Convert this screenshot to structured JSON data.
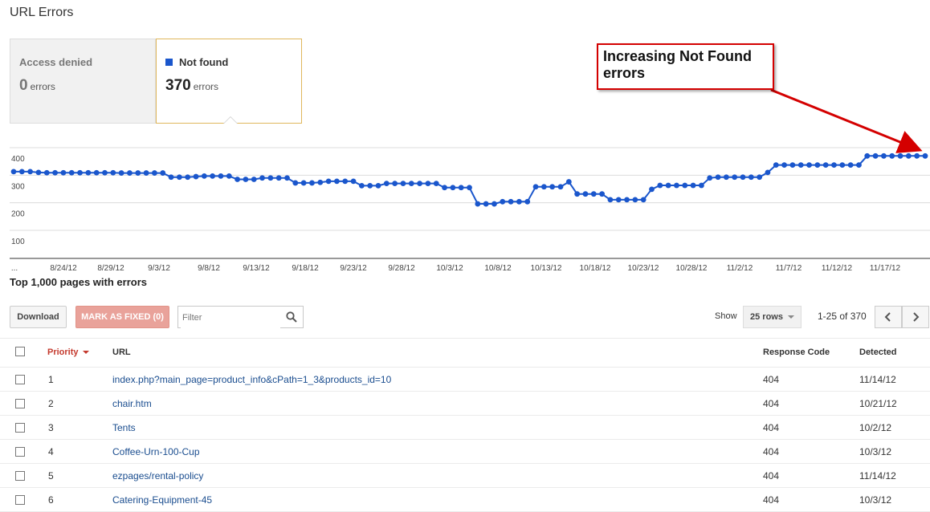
{
  "page": {
    "title": "URL Errors"
  },
  "tiles": [
    {
      "label": "Access denied",
      "count": "0",
      "unit": "errors",
      "selected": false
    },
    {
      "label": "Not found",
      "count": "370",
      "unit": "errors",
      "selected": true,
      "color": "#1a56cc"
    }
  ],
  "annotation": {
    "line1": "Increasing Not Found",
    "line2": "errors",
    "color": "#d40000"
  },
  "chart_data": {
    "type": "line",
    "series": [
      {
        "name": "Not found",
        "color": "#1a56cc",
        "values": [
          313,
          313,
          313,
          310,
          309,
          309,
          309,
          309,
          309,
          309,
          309,
          309,
          309,
          308,
          308,
          308,
          308,
          308,
          308,
          293,
          293,
          293,
          295,
          297,
          297,
          297,
          297,
          285,
          285,
          285,
          290,
          290,
          290,
          290,
          272,
          272,
          272,
          274,
          278,
          278,
          278,
          278,
          262,
          262,
          262,
          270,
          270,
          270,
          270,
          270,
          270,
          270,
          255,
          255,
          255,
          255,
          196,
          196,
          196,
          204,
          204,
          204,
          204,
          258,
          258,
          258,
          258,
          276,
          232,
          232,
          232,
          232,
          211,
          211,
          211,
          211,
          211,
          249,
          263,
          263,
          263,
          263,
          263,
          263,
          290,
          293,
          293,
          293,
          293,
          293,
          293,
          310,
          337,
          337,
          337,
          337,
          337,
          337,
          337,
          337,
          337,
          337,
          337,
          370,
          370,
          370,
          370,
          370,
          370,
          370,
          370
        ]
      }
    ],
    "ylim": [
      0,
      400
    ],
    "yticks": [
      "400",
      "300",
      "200",
      "100"
    ],
    "xlabels": [
      "...",
      "8/24/12",
      "8/29/12",
      "9/3/12",
      "9/8/12",
      "9/13/12",
      "9/18/12",
      "9/23/12",
      "9/28/12",
      "10/3/12",
      "10/8/12",
      "10/13/12",
      "10/18/12",
      "10/23/12",
      "10/28/12",
      "11/2/12",
      "11/7/12",
      "11/12/12",
      "11/17/12"
    ],
    "grid": true
  },
  "table_section": {
    "title": "Top 1,000 pages with errors"
  },
  "toolbar": {
    "download_label": "Download",
    "mark_fixed_label": "MARK AS FIXED (0)",
    "filter_placeholder": "Filter",
    "show_label": "Show",
    "rows_value": "25 rows",
    "range_text": "1-25 of 370",
    "prev_icon": "chevron-left-icon",
    "next_icon": "chevron-right-icon"
  },
  "table": {
    "headers": {
      "priority": "Priority",
      "url": "URL",
      "response": "Response Code",
      "detected": "Detected"
    },
    "rows": [
      {
        "priority": "1",
        "url": "index.php?main_page=product_info&cPath=1_3&products_id=10",
        "code": "404",
        "detected": "11/14/12"
      },
      {
        "priority": "2",
        "url": "chair.htm",
        "code": "404",
        "detected": "10/21/12"
      },
      {
        "priority": "3",
        "url": "Tents",
        "code": "404",
        "detected": "10/2/12"
      },
      {
        "priority": "4",
        "url": "Coffee-Urn-100-Cup",
        "code": "404",
        "detected": "10/3/12"
      },
      {
        "priority": "5",
        "url": "ezpages/rental-policy",
        "code": "404",
        "detected": "11/14/12"
      },
      {
        "priority": "6",
        "url": "Catering-Equipment-45",
        "code": "404",
        "detected": "10/3/12"
      }
    ]
  }
}
